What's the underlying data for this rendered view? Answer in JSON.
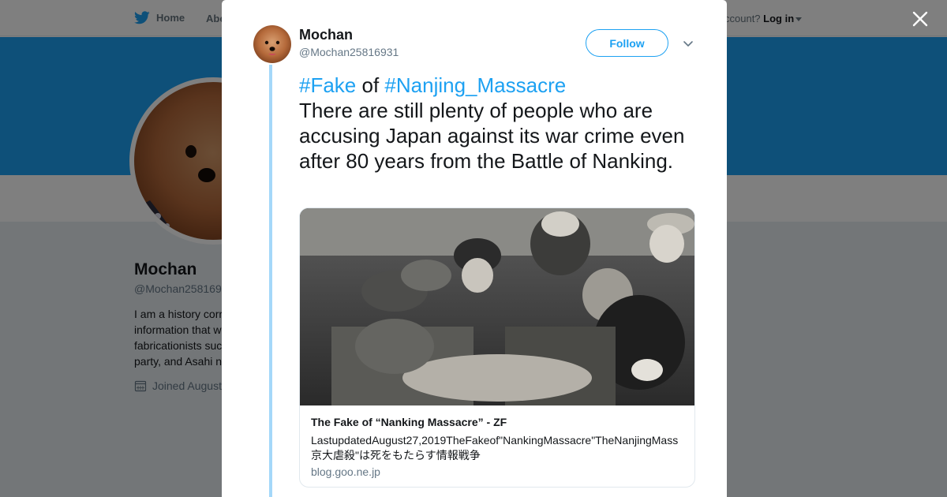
{
  "colors": {
    "accent": "#1da1f2",
    "overlay": "rgba(0,0,0,0.5)",
    "thread": "#a4d8f9"
  },
  "topnav": {
    "home_label": "Home",
    "about_label": "Abo",
    "account_text": "ccount?",
    "login_label": "Log in",
    "icons": [
      "twitter-bird-icon",
      "caret-down-icon"
    ]
  },
  "profile": {
    "name": "Mochan",
    "handle": "@Mochan258169",
    "bio_lines": [
      "I am a history corr",
      "information that w",
      "fabricationists suc",
      "party, and Asahi n"
    ],
    "joined": "Joined August"
  },
  "modal": {
    "close_icon": "close-icon",
    "tweet": {
      "author_name": "Mochan",
      "author_handle": "@Mochan25816931",
      "follow_label": "Follow",
      "menu_icon": "chevron-down-icon",
      "hashtag1": "#Fake",
      "connector": " of ",
      "hashtag2": "#Nanjing_Massacre",
      "body": "There are still plenty of people who are accusing Japan against its war crime even after 80 years from the Battle of Nanking."
    },
    "card": {
      "title": "The Fake of “Nanking Massacre” - ZF",
      "description_line1": "LastupdatedAugust27,2019TheFakeof\"NankingMassacre\"TheNanjingMass",
      "description_line2": "京大虐殺\"は死をもたらす情報戦争",
      "domain": "blog.goo.ne.jp"
    }
  }
}
